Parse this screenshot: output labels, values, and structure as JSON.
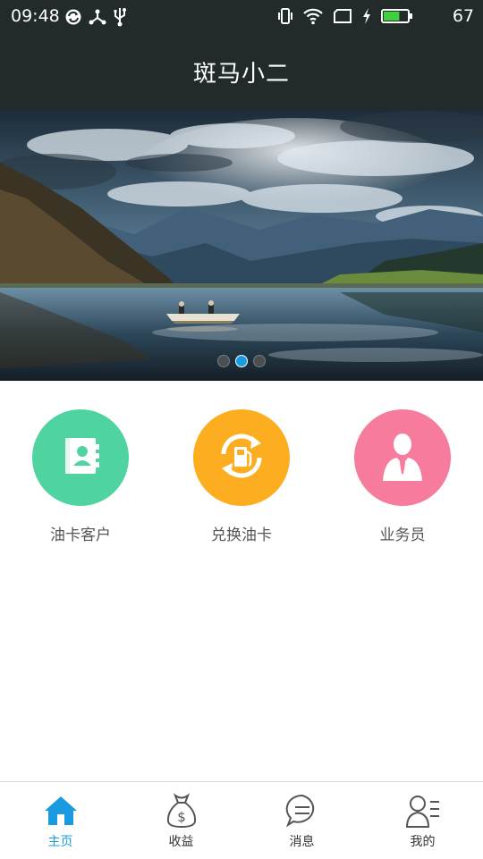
{
  "status_bar": {
    "time": "09:48",
    "battery_percent": "67",
    "battery_level": 0.67,
    "icons_left": [
      "sync-icon",
      "share-icon",
      "usb-icon"
    ],
    "icons_right": [
      "vibrate-icon",
      "wifi-icon",
      "sim-icon",
      "charging-icon",
      "battery-icon"
    ]
  },
  "header": {
    "title": "斑马小二"
  },
  "banner": {
    "slide_count": 3,
    "active_index": 1
  },
  "menu": {
    "items": [
      {
        "label": "油卡客户",
        "icon": "contact-book-icon",
        "color": "#4fd3a1"
      },
      {
        "label": "兑换油卡",
        "icon": "fuel-exchange-icon",
        "color": "#fcae20"
      },
      {
        "label": "业务员",
        "icon": "salesman-icon",
        "color": "#f77b9c"
      }
    ]
  },
  "tabbar": {
    "active_color": "#1a9be0",
    "tabs": [
      {
        "label": "主页",
        "icon": "home-icon",
        "active": true
      },
      {
        "label": "收益",
        "icon": "money-bag-icon",
        "active": false
      },
      {
        "label": "消息",
        "icon": "message-icon",
        "active": false
      },
      {
        "label": "我的",
        "icon": "profile-icon",
        "active": false
      }
    ]
  }
}
